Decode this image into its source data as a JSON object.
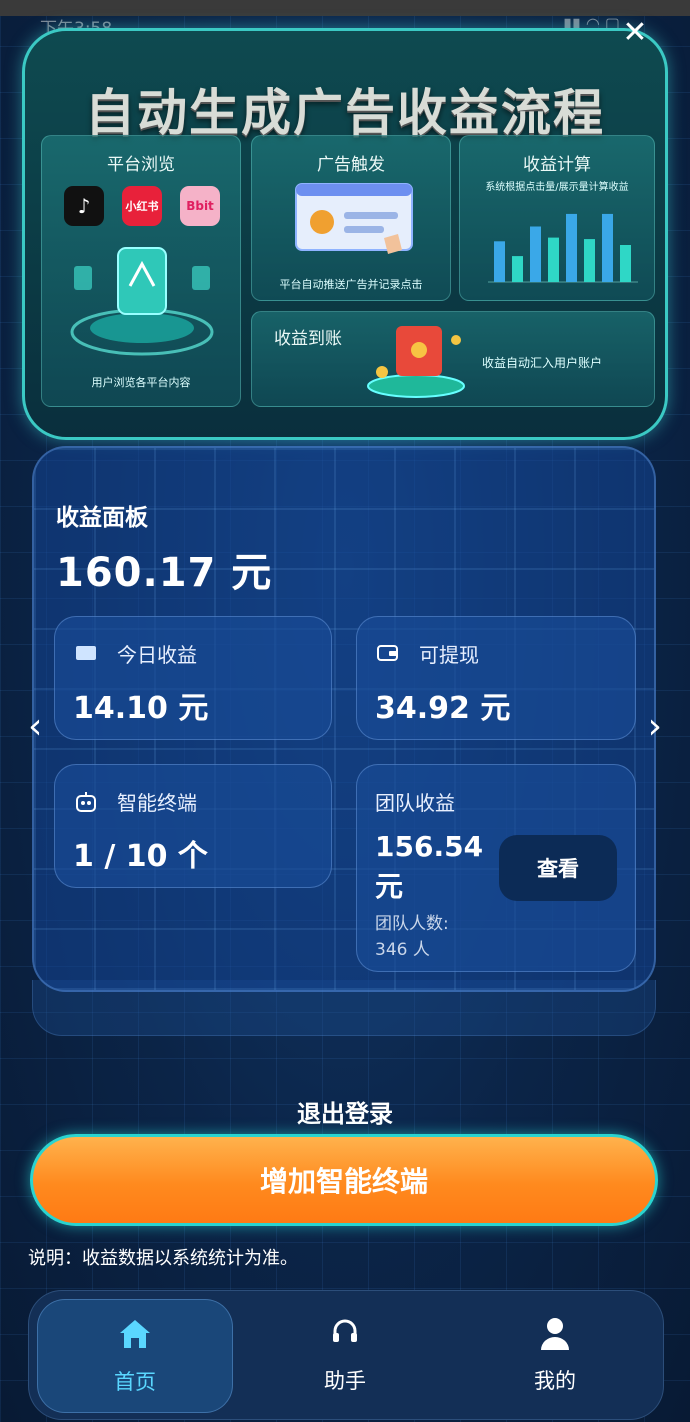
{
  "status": {
    "time": "下午3:58",
    "icons": "▮▮ ◠ ▢"
  },
  "banner": {
    "title": "自动生成广告收益流程",
    "cards": {
      "browse": {
        "title": "平台浏览",
        "desc": "用户浏览各平台内容",
        "apps": [
          "♪",
          "小红书",
          "Bbit"
        ]
      },
      "trigger": {
        "title": "广告触发",
        "desc": "平台自动推送广告并记录点击"
      },
      "calc": {
        "title": "收益计算",
        "desc": "系统根据点击量/展示量计算收益",
        "bar_values": [
          0.55,
          0.35,
          0.75,
          0.6,
          0.92,
          0.58,
          0.92,
          0.5
        ]
      },
      "arrive": {
        "title": "收益到账",
        "desc": "收益自动汇入用户账户"
      }
    }
  },
  "panel": {
    "title": "收益面板",
    "total": "160.17 元",
    "today": {
      "label": "今日收益",
      "value": "14.10 元"
    },
    "withdraw": {
      "label": "可提现",
      "value": "34.92 元"
    },
    "terminal": {
      "label": "智能终端",
      "value": "1 / 10 个"
    },
    "team": {
      "label": "团队收益",
      "value": "156.54\n元",
      "count_label": "团队人数:",
      "count": "346 人",
      "view_label": "查看"
    }
  },
  "nav": {
    "prev": "‹",
    "next": "›",
    "close": "✕"
  },
  "logout_label": "退出登录",
  "add_terminal_label": "增加智能终端",
  "note": "说明：收益数据以系统统计为准。",
  "tabs": [
    {
      "label": "首页",
      "icon": "home-icon",
      "active": true
    },
    {
      "label": "助手",
      "icon": "headset-icon",
      "active": false
    },
    {
      "label": "我的",
      "icon": "user-icon",
      "active": false
    }
  ],
  "colors": {
    "accent": "#3bc9c4",
    "tab_active": "#5ad7ff",
    "button": "#ff8a1e",
    "bg": "#0a1f3e"
  }
}
